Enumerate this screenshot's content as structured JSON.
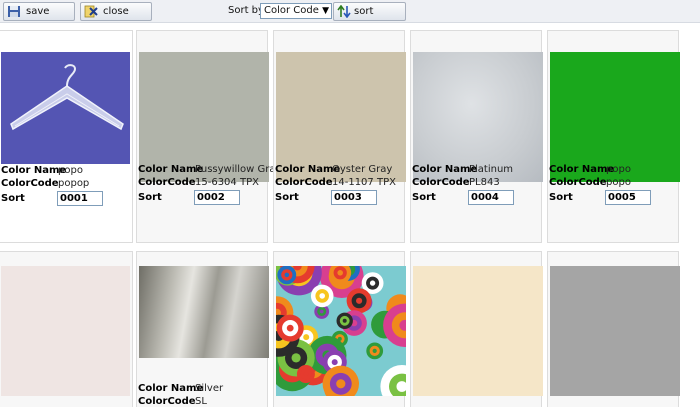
{
  "toolbar": {
    "save_label": "save",
    "close_label": "close",
    "sortby_label": "Sort by:",
    "sortby_value": "Color Code",
    "sort_label": "sort"
  },
  "labels": {
    "name": "Color Name",
    "code": "ColorCode",
    "sort": "Sort"
  },
  "colors": [
    {
      "name": "popo",
      "code": "popop",
      "sort": "0001",
      "swatch": "hanger",
      "color": "#5455b3"
    },
    {
      "name": "Pussywillow Gray",
      "code": "15-6304 TPX",
      "sort": "0002",
      "swatch": "solid",
      "color": "#b1b4aa"
    },
    {
      "name": "Oyster Gray",
      "code": "14-1107 TPX",
      "sort": "0003",
      "swatch": "solid",
      "color": "#cdc4ad"
    },
    {
      "name": "Platinum",
      "code": "PL843",
      "sort": "0004",
      "swatch": "metal",
      "color": "#c8ccd0"
    },
    {
      "name": "popo",
      "code": "popo",
      "sort": "0005",
      "swatch": "solid",
      "color": "#1aa81c"
    },
    {
      "name": "",
      "code": "",
      "sort": "",
      "swatch": "solid",
      "color": "#efe5e3"
    },
    {
      "name": "Silver",
      "code": "SL",
      "sort": "",
      "swatch": "silver",
      "color": "#a8a79f"
    },
    {
      "name": "",
      "code": "",
      "sort": "",
      "swatch": "pattern",
      "color": "#8fd0cf"
    },
    {
      "name": "",
      "code": "",
      "sort": "",
      "swatch": "solid",
      "color": "#f5e6c8"
    },
    {
      "name": "",
      "code": "",
      "sort": "",
      "swatch": "solid",
      "color": "#a5a5a5"
    }
  ]
}
